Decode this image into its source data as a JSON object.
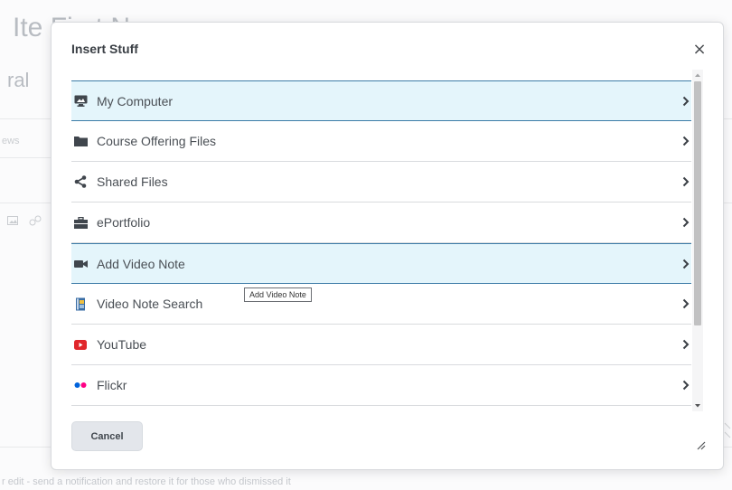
{
  "background": {
    "title_fragment": "Ite      First N",
    "subtitle_fragment": "ral",
    "tab_fragment": "ews",
    "footer_text": "r edit - send a notification and restore it for those who dismissed it"
  },
  "dialog": {
    "title": "Insert Stuff",
    "close_label": "×",
    "items": [
      {
        "label": "My Computer",
        "icon": "monitor-icon",
        "highlighted": true
      },
      {
        "label": "Course Offering Files",
        "icon": "folder-icon",
        "highlighted": false
      },
      {
        "label": "Shared Files",
        "icon": "share-icon",
        "highlighted": false
      },
      {
        "label": "ePortfolio",
        "icon": "briefcase-icon",
        "highlighted": false
      },
      {
        "label": "Add Video Note",
        "icon": "video-camera-icon",
        "highlighted": true
      },
      {
        "label": "Video Note Search",
        "icon": "video-search-icon",
        "highlighted": false
      },
      {
        "label": "YouTube",
        "icon": "youtube-icon",
        "highlighted": false
      },
      {
        "label": "Flickr",
        "icon": "flickr-icon",
        "highlighted": false
      }
    ],
    "tooltip": "Add Video Note",
    "cancel_label": "Cancel"
  },
  "colors": {
    "highlight_bg": "#e4f5fb",
    "highlight_border": "#3d7ca7",
    "youtube_red": "#e0262b",
    "flickr_blue": "#0063dc",
    "flickr_pink": "#ff0084"
  }
}
